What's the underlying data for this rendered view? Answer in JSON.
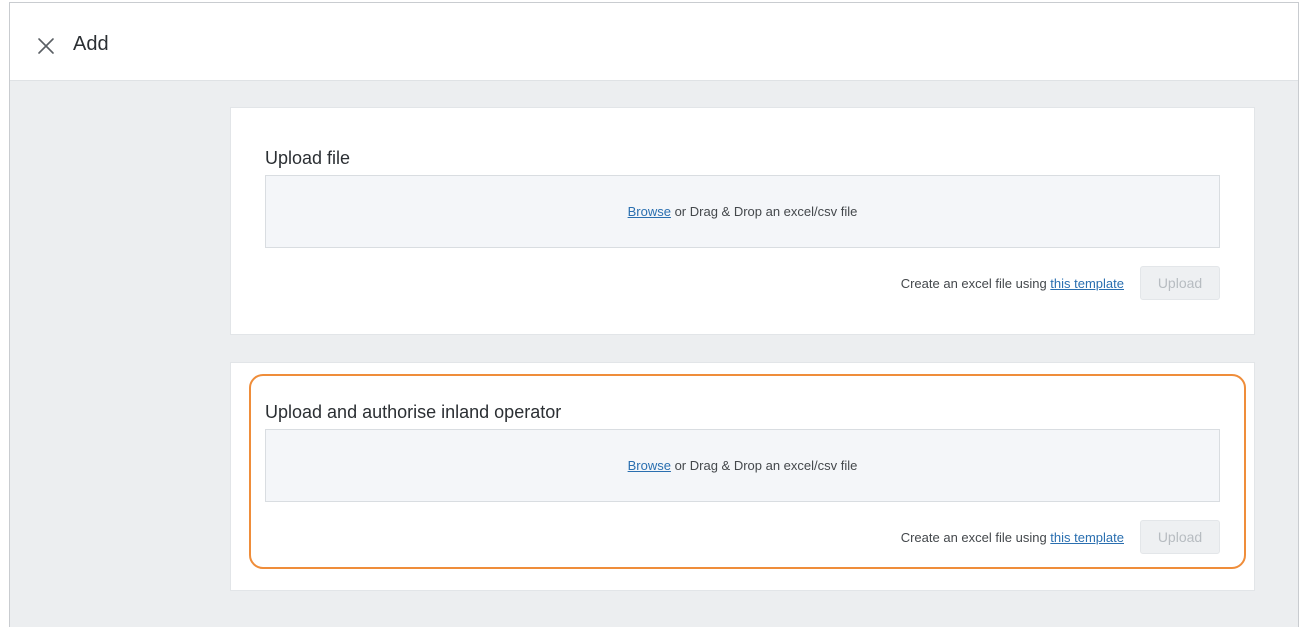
{
  "header": {
    "title": "Add",
    "close_icon": "close-icon"
  },
  "sections": [
    {
      "title": "Upload file",
      "dropzone": {
        "browse_label": "Browse",
        "instruction": " or Drag & Drop an excel/csv file"
      },
      "template_prefix": "Create an excel file using ",
      "template_link": "this template",
      "upload_label": "Upload"
    },
    {
      "title": "Upload and authorise inland operator",
      "dropzone": {
        "browse_label": "Browse",
        "instruction": " or Drag & Drop an excel/csv file"
      },
      "template_prefix": "Create an excel file using ",
      "template_link": "this template",
      "upload_label": "Upload"
    }
  ],
  "colors": {
    "highlight": "#ef8d3a",
    "link": "#2a6fb0",
    "background": "#eceef0"
  }
}
